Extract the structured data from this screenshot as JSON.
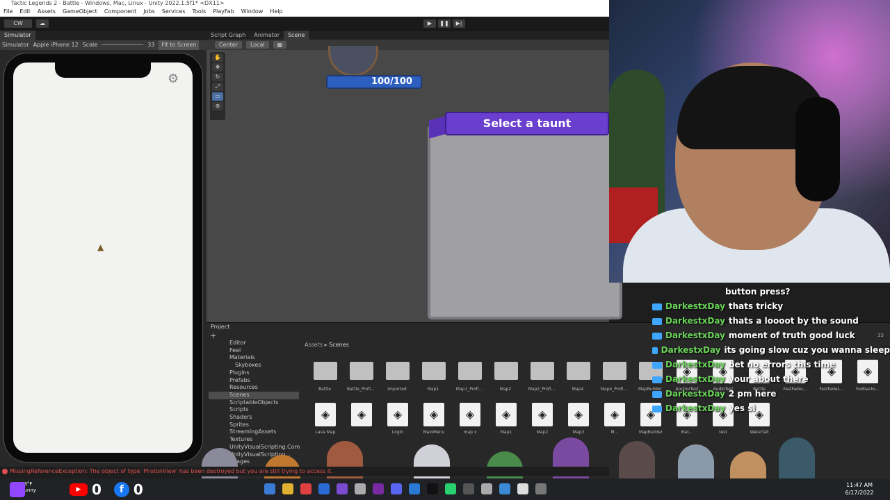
{
  "title": "Tactic Legends 2 - Battle - Windows, Mac, Linux - Unity 2022.1.5f1* <DX11>",
  "menu": [
    "File",
    "Edit",
    "Assets",
    "GameObject",
    "Component",
    "Jobs",
    "Services",
    "Tools",
    "PlayFab",
    "Window",
    "Help"
  ],
  "toolbar": {
    "account": "CW",
    "play": "▶",
    "pause": "❚❚",
    "step": "▶|"
  },
  "simulator": {
    "tab": "Simulator",
    "mode": "Simulator",
    "device": "Apple iPhone 12",
    "scale_label": "Scale",
    "scale_value": "33",
    "fit_button": "Fit to Screen"
  },
  "scene": {
    "tabs": [
      "Script Graph",
      "Animator",
      "Scene"
    ],
    "pivot": "Center",
    "space": "Local",
    "hp": "100/100",
    "taunt_title": "Select a taunt"
  },
  "project": {
    "tab": "Project",
    "tree": [
      "Editor",
      "Feel",
      "Materials",
      "Skyboxes",
      "Plugins",
      "Prefabs",
      "Resources",
      "Scenes",
      "ScriptableObjects",
      "Scripts",
      "Shaders",
      "Sprites",
      "StreamingAssets",
      "Textures",
      "UnityVisualScripting.Com",
      "UnityVisualScripting...",
      "Images"
    ],
    "breadcrumb_root": "Assets",
    "breadcrumb_current": "Scenes",
    "folders": [
      "Battle",
      "Battle_Profi...",
      "Imported",
      "Map1",
      "Map1_Profi...",
      "Map2",
      "Map2_Profi...",
      "Map4",
      "Map4_Profi...",
      "MapBuilder"
    ],
    "row1_scenes": [
      "AnchorTest",
      "AudioTest",
      "Battle",
      "FastFadeL...",
      "FastFadeL...",
      "Fedbacks..."
    ],
    "row2_scenes": [
      "Lava Map",
      "",
      "Login",
      "MainMenu",
      "map x",
      "Map1",
      "Map2",
      "Map3",
      "M...",
      "MapBuilder",
      "Mat...",
      "test",
      "Waterfall"
    ],
    "asset_count": "33"
  },
  "chat": [
    {
      "name": "",
      "message": "button press?"
    },
    {
      "name": "DarkestxDay",
      "message": "thats tricky"
    },
    {
      "name": "DarkestxDay",
      "message": "thats a loooot by the sound"
    },
    {
      "name": "DarkestxDay",
      "message": "moment of truth good luck"
    },
    {
      "name": "DarkestxDay",
      "message": "its going slow cuz you wanna sleep"
    },
    {
      "name": "DarkestxDay",
      "message": "bet no errors this time"
    },
    {
      "name": "DarkestxDay",
      "message": "your about there"
    },
    {
      "name": "DarkestxDay",
      "message": "2 pm here"
    },
    {
      "name": "DarkestxDay",
      "message": "yes si"
    }
  ],
  "error": "MissingReferenceException: The object of type 'PhotonView' has been destroyed but you are still trying to access it.",
  "socials": {
    "youtube_count": "0",
    "facebook_count": "0"
  },
  "taskbar": {
    "weather": "73°F Sunny",
    "time": "11:47 AM",
    "date": "6/17/2022"
  },
  "colors": {
    "accent": "#6a3fd0",
    "hp_bar": "#2d5fc0",
    "chat_name": "#6bd45a",
    "error": "#e05050"
  }
}
